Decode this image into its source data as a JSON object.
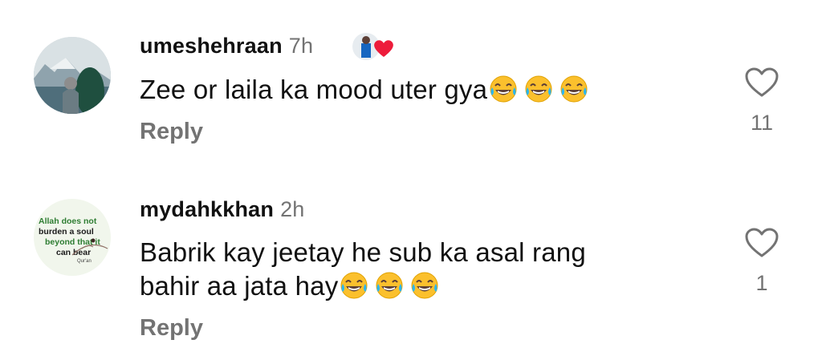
{
  "comments": [
    {
      "username": "umeshehraan",
      "time": "7h",
      "text": "Zee or laila ka mood uter gya",
      "emoji_count": 3,
      "reply_label": "Reply",
      "likes": "11"
    },
    {
      "username": "mydahkkhan",
      "time": "2h",
      "text_line1": "Babrik kay jeetay he sub ka asal rang",
      "text_line2": "bahir aa jata hay",
      "emoji_count": 3,
      "reply_label": "Reply",
      "likes": "1",
      "avatar_text": {
        "line1": "Allah does not",
        "line2": "burden a soul",
        "line3": "beyond that it",
        "line4": "can bear",
        "line5": "Qur'an"
      }
    }
  ],
  "colors": {
    "primary_text": "#111111",
    "secondary_text": "#737373",
    "heart_red": "#ed1c3b",
    "emoji_yellow": "#fbc02d",
    "tear_blue": "#29b6f6"
  },
  "icons": {
    "like": "heart-outline-icon",
    "liked_by_creator": "heart-filled-icon",
    "emoji": "face-with-tears-of-joy-emoji"
  }
}
